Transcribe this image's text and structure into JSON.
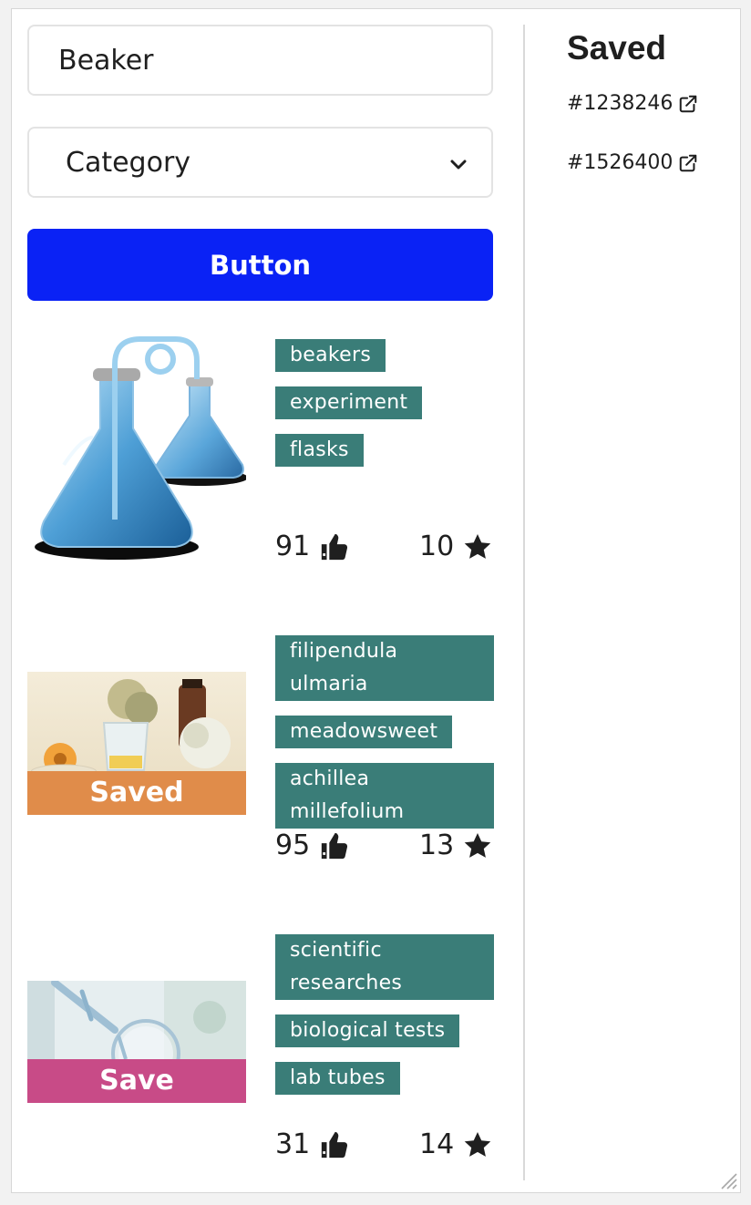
{
  "search": {
    "value": "Beaker"
  },
  "category": {
    "label": "Category"
  },
  "primary_button": {
    "label": "Button"
  },
  "results": [
    {
      "tags": [
        "beakers",
        "experiment",
        "flasks"
      ],
      "likes": "91",
      "stars": "10"
    },
    {
      "tags": [
        "filipendula ulmaria",
        "meadowsweet",
        "achillea millefolium"
      ],
      "likes": "95",
      "stars": "13",
      "save_label": "Saved"
    },
    {
      "tags": [
        "scientific researches",
        "biological tests",
        "lab tubes"
      ],
      "likes": "31",
      "stars": "14",
      "save_label": "Save"
    }
  ],
  "saved_panel": {
    "title": "Saved",
    "items": [
      "#1238246",
      "#1526400"
    ]
  },
  "colors": {
    "primary": "#0a22f5",
    "tag": "#3a7d78",
    "saved_strip": "#e08c4a",
    "save_strip": "#c84b87"
  },
  "icons": [
    "chevron-down-icon",
    "thumbs-up-icon",
    "star-icon",
    "external-link-icon",
    "resize-grip-icon"
  ]
}
